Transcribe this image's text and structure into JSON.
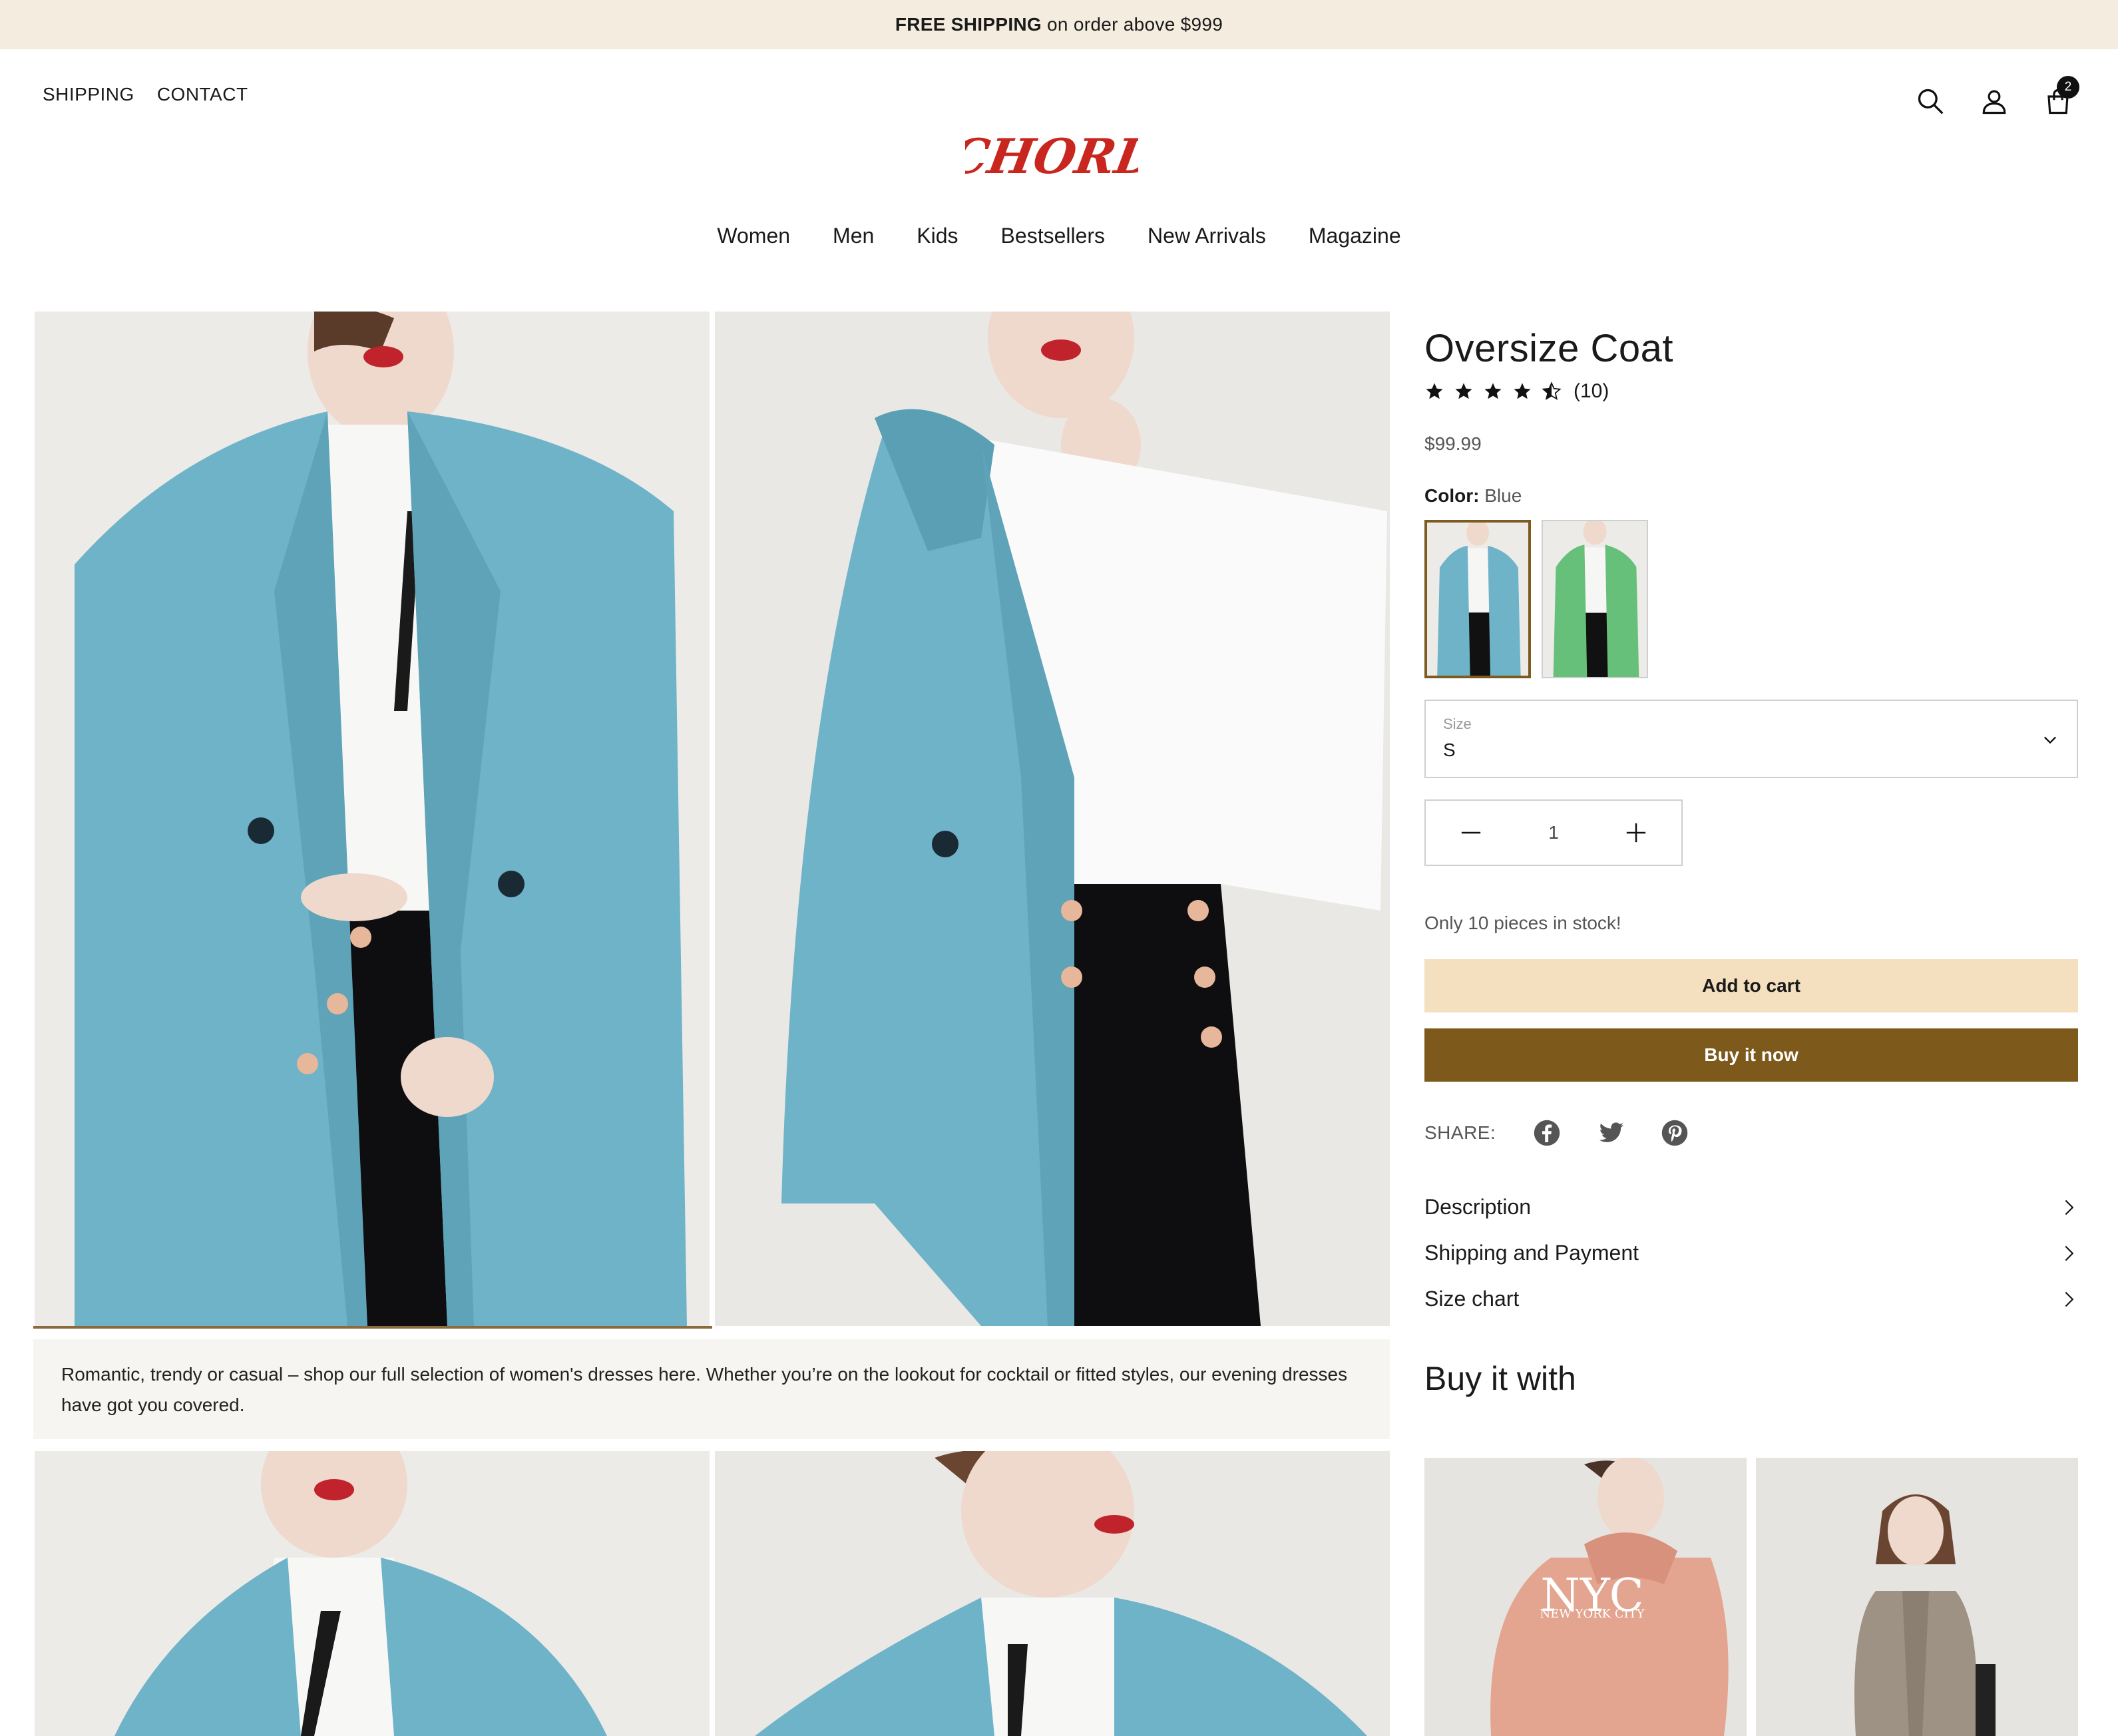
{
  "announcement": {
    "bold": "FREE SHIPPING",
    "text": "on order above $999"
  },
  "util_nav": [
    "SHIPPING",
    "CONTACT"
  ],
  "header": {
    "cart_count": "2",
    "logo_text": "CHORD"
  },
  "main_nav": [
    "Women",
    "Men",
    "Kids",
    "Bestsellers",
    "New Arrivals",
    "Magazine"
  ],
  "gallery": {
    "description": "Romantic, trendy or casual – shop our full selection of women's dresses here. Whether you’re on the lookout for cocktail or fitted styles, our evening dresses have got you covered."
  },
  "product": {
    "title": "Oversize Coat",
    "rating": 4.5,
    "review_count": "(10)",
    "price": "$99.99",
    "color_label": "Color:",
    "color_value": "Blue",
    "swatches": [
      {
        "name": "Blue",
        "color": "#6fb3c8",
        "selected": true
      },
      {
        "name": "Green",
        "color": "#66c07a",
        "selected": false
      }
    ],
    "size_label": "Size",
    "size_value": "S",
    "quantity": "1",
    "stock_text": "Only 10 pieces in stock!",
    "add_to_cart": "Add to cart",
    "buy_now": "Buy it now",
    "share_label": "SHARE:",
    "share_icons": [
      "facebook-icon",
      "twitter-icon",
      "pinterest-icon"
    ],
    "accordion": [
      "Description",
      "Shipping and Payment",
      "Size chart"
    ],
    "buy_with_title": "Buy it with",
    "buy_with_products": [
      {
        "name": "NYC hoodie",
        "print": "NEW YORK CITY",
        "print_big": "NYC",
        "color": "#e3a590"
      },
      {
        "name": "Beige coat",
        "color": "#9d9283"
      }
    ]
  },
  "colors": {
    "announcement_bg": "#f3ecdf",
    "accent": "#7d5a1c",
    "cart_button": "#f4dfbf",
    "logo": "#c8261e",
    "coat_blue": "#6fb3c8"
  }
}
